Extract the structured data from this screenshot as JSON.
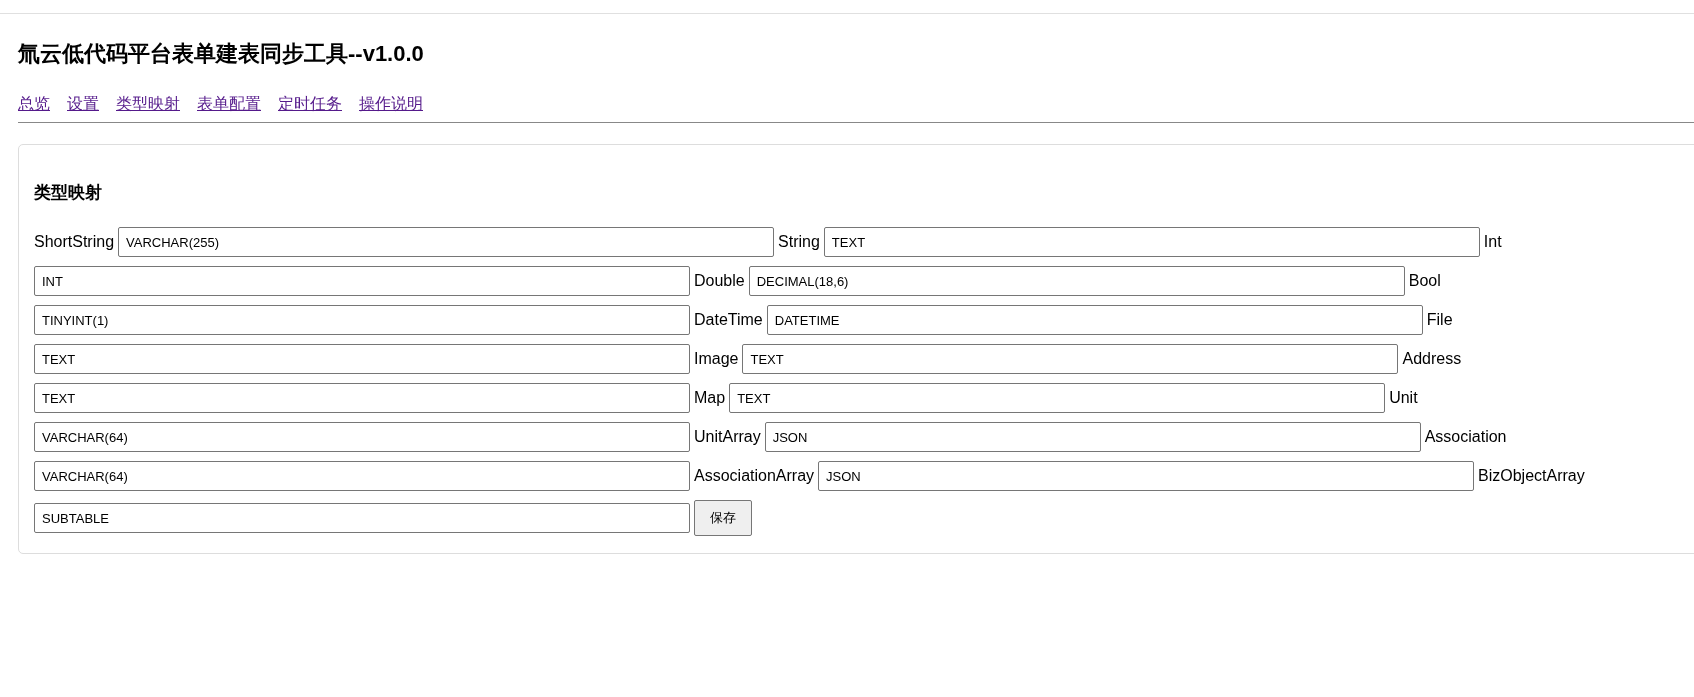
{
  "title": "氚云低代码平台表单建表同步工具--v1.0.0",
  "nav": [
    {
      "label": "总览"
    },
    {
      "label": "设置"
    },
    {
      "label": "类型映射"
    },
    {
      "label": "表单配置"
    },
    {
      "label": "定时任务"
    },
    {
      "label": "操作说明"
    }
  ],
  "section": {
    "heading": "类型映射",
    "items": [
      {
        "kind": "label",
        "text": "ShortString"
      },
      {
        "kind": "field",
        "value": "VARCHAR(255)"
      },
      {
        "kind": "label",
        "text": "String"
      },
      {
        "kind": "field",
        "value": "TEXT"
      },
      {
        "kind": "label",
        "text": "Int"
      },
      {
        "kind": "field",
        "value": "INT"
      },
      {
        "kind": "label",
        "text": "Double"
      },
      {
        "kind": "field",
        "value": "DECIMAL(18,6)"
      },
      {
        "kind": "label",
        "text": "Bool"
      },
      {
        "kind": "field",
        "value": "TINYINT(1)"
      },
      {
        "kind": "label",
        "text": "DateTime"
      },
      {
        "kind": "field",
        "value": "DATETIME"
      },
      {
        "kind": "label",
        "text": "File"
      },
      {
        "kind": "field",
        "value": "TEXT"
      },
      {
        "kind": "label",
        "text": "Image"
      },
      {
        "kind": "field",
        "value": "TEXT"
      },
      {
        "kind": "label",
        "text": "Address"
      },
      {
        "kind": "field",
        "value": "TEXT"
      },
      {
        "kind": "label",
        "text": "Map"
      },
      {
        "kind": "field",
        "value": "TEXT"
      },
      {
        "kind": "label",
        "text": "Unit"
      },
      {
        "kind": "field",
        "value": "VARCHAR(64)"
      },
      {
        "kind": "label",
        "text": "UnitArray"
      },
      {
        "kind": "field",
        "value": "JSON"
      },
      {
        "kind": "label",
        "text": "Association"
      },
      {
        "kind": "field",
        "value": "VARCHAR(64)"
      },
      {
        "kind": "label",
        "text": "AssociationArray"
      },
      {
        "kind": "field",
        "value": "JSON"
      },
      {
        "kind": "label",
        "text": "BizObjectArray"
      },
      {
        "kind": "field",
        "value": "SUBTABLE"
      }
    ],
    "save_button": "保存"
  }
}
